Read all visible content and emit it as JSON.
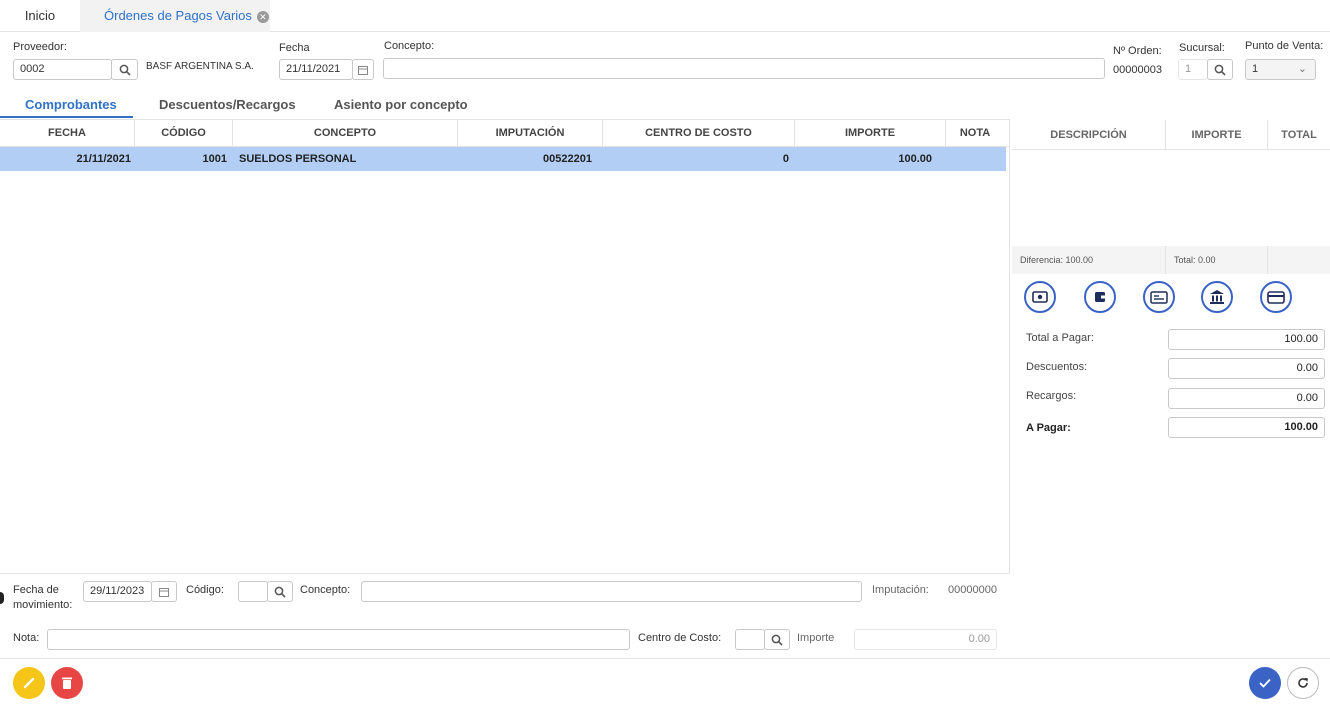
{
  "tabs": {
    "inicio": "Inicio",
    "ordenes": "Órdenes de Pagos Varios"
  },
  "header": {
    "proveedor_label": "Proveedor:",
    "proveedor_value": "0002",
    "proveedor_name": "BASF ARGENTINA S.A.",
    "fecha_label": "Fecha",
    "fecha_value": "21/11/2021",
    "concepto_label": "Concepto:",
    "concepto_value": "",
    "orden_label": "Nº Orden:",
    "orden_value": "00000003",
    "sucursal_label": "Sucursal:",
    "sucursal_value": "1",
    "punto_venta_label": "Punto de Venta:",
    "punto_venta_value": "1"
  },
  "subtabs": {
    "comprobantes": "Comprobantes",
    "descuentos": "Descuentos/Recargos",
    "asiento": "Asiento por concepto"
  },
  "grid": {
    "columns": [
      "FECHA",
      "CÓDIGO",
      "CONCEPTO",
      "IMPUTACIÓN",
      "CENTRO DE COSTO",
      "IMPORTE",
      "NOTA"
    ],
    "rows": [
      {
        "fecha": "21/11/2021",
        "codigo": "1001",
        "concepto": "SUELDOS PERSONAL",
        "imputacion": "00522201",
        "centro": "0",
        "importe": "100.00",
        "nota": ""
      }
    ]
  },
  "payments": {
    "columns": [
      "DESCRIPCIÓN",
      "IMPORTE",
      "TOTAL"
    ],
    "diferencia": "Diferencia: 100.00",
    "total": "Total: 0.00"
  },
  "totals": {
    "total_pagar_label": "Total a Pagar:",
    "total_pagar_value": "100.00",
    "descuentos_label": "Descuentos:",
    "descuentos_value": "0.00",
    "recargos_label": "Recargos:",
    "recargos_value": "0.00",
    "a_pagar_label": "A Pagar:",
    "a_pagar_value": "100.00"
  },
  "form": {
    "fecha_mov_label": "Fecha de movimiento:",
    "fecha_mov_value": "29/11/2023",
    "codigo_label": "Código:",
    "codigo_value": "",
    "concepto_label": "Concepto:",
    "concepto_value": "",
    "imputacion_label": "Imputación:",
    "imputacion_value": "00000000",
    "nota_label": "Nota:",
    "nota_value": "",
    "centro_label": "Centro de Costo:",
    "centro_value": "",
    "importe_label": "Importe",
    "importe_value": "0.00"
  },
  "colors": {
    "accent": "#2f72c8",
    "selected_row": "#b3cef5",
    "edit": "#f5c518",
    "delete": "#e84545",
    "confirm": "#3b63c6"
  }
}
